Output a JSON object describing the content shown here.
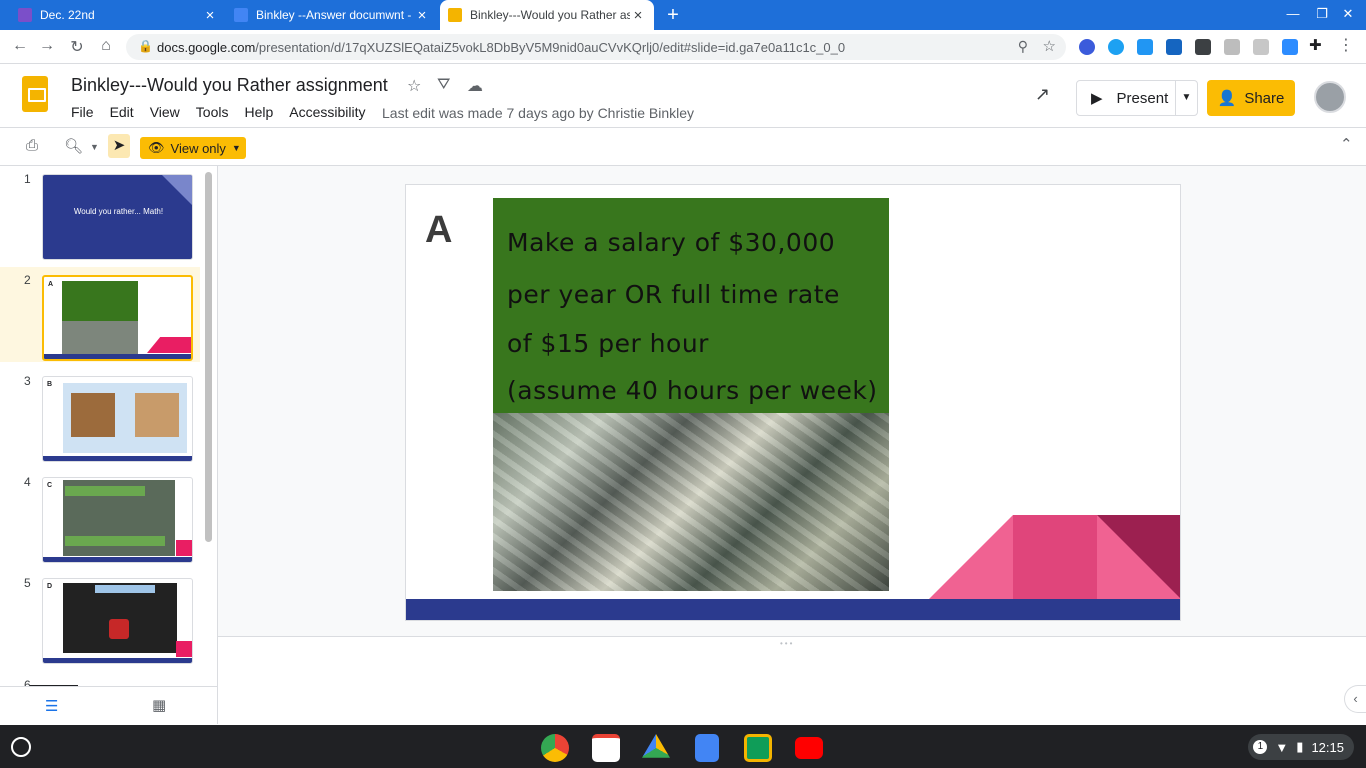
{
  "browser": {
    "tabs": [
      {
        "title": "Dec. 22nd",
        "icon": "classroom-icon",
        "color": "#7b4fc9"
      },
      {
        "title": "Binkley --Answer documwnt - Go",
        "icon": "docs-icon",
        "color": "#4285f4"
      },
      {
        "title": "Binkley---Would you Rather assig",
        "icon": "slides-icon",
        "color": "#f4b400",
        "active": true
      }
    ],
    "url_domain": "docs.google.com",
    "url_path": "/presentation/d/17qXUZSlEQataiZ5vokL8DbByV5M9nid0auCVvKQrlj0/edit#slide=id.ga7e0a11c1c_0_0"
  },
  "app": {
    "title": "Binkley---Would you Rather assignment",
    "menus": [
      "File",
      "Edit",
      "View",
      "Tools",
      "Help",
      "Accessibility"
    ],
    "last_edit": "Last edit was made 7 days ago by Christie Binkley",
    "present_label": "Present",
    "share_label": "Share",
    "view_only_label": "View only"
  },
  "filmstrip": {
    "slides": [
      {
        "num": "1",
        "caption": "Would you rather... Math!"
      },
      {
        "num": "2",
        "caption": "A"
      },
      {
        "num": "3",
        "caption": "B"
      },
      {
        "num": "4",
        "caption": "C"
      },
      {
        "num": "5",
        "caption": "D"
      }
    ],
    "partial_num": "6"
  },
  "slide": {
    "letter": "A",
    "lines": [
      "Make a salary of $30,000",
      "per year OR full time rate",
      "of $15 per hour",
      "(assume 40 hours per week)"
    ]
  },
  "shelf": {
    "notification_count": "1",
    "time": "12:15"
  },
  "colors": {
    "tab_bar": "#1e6fd9",
    "accent_yellow": "#fbbc04",
    "slide_green": "#38761d",
    "slide_navy": "#2b3a8e",
    "slide_pink": "#f06292"
  }
}
